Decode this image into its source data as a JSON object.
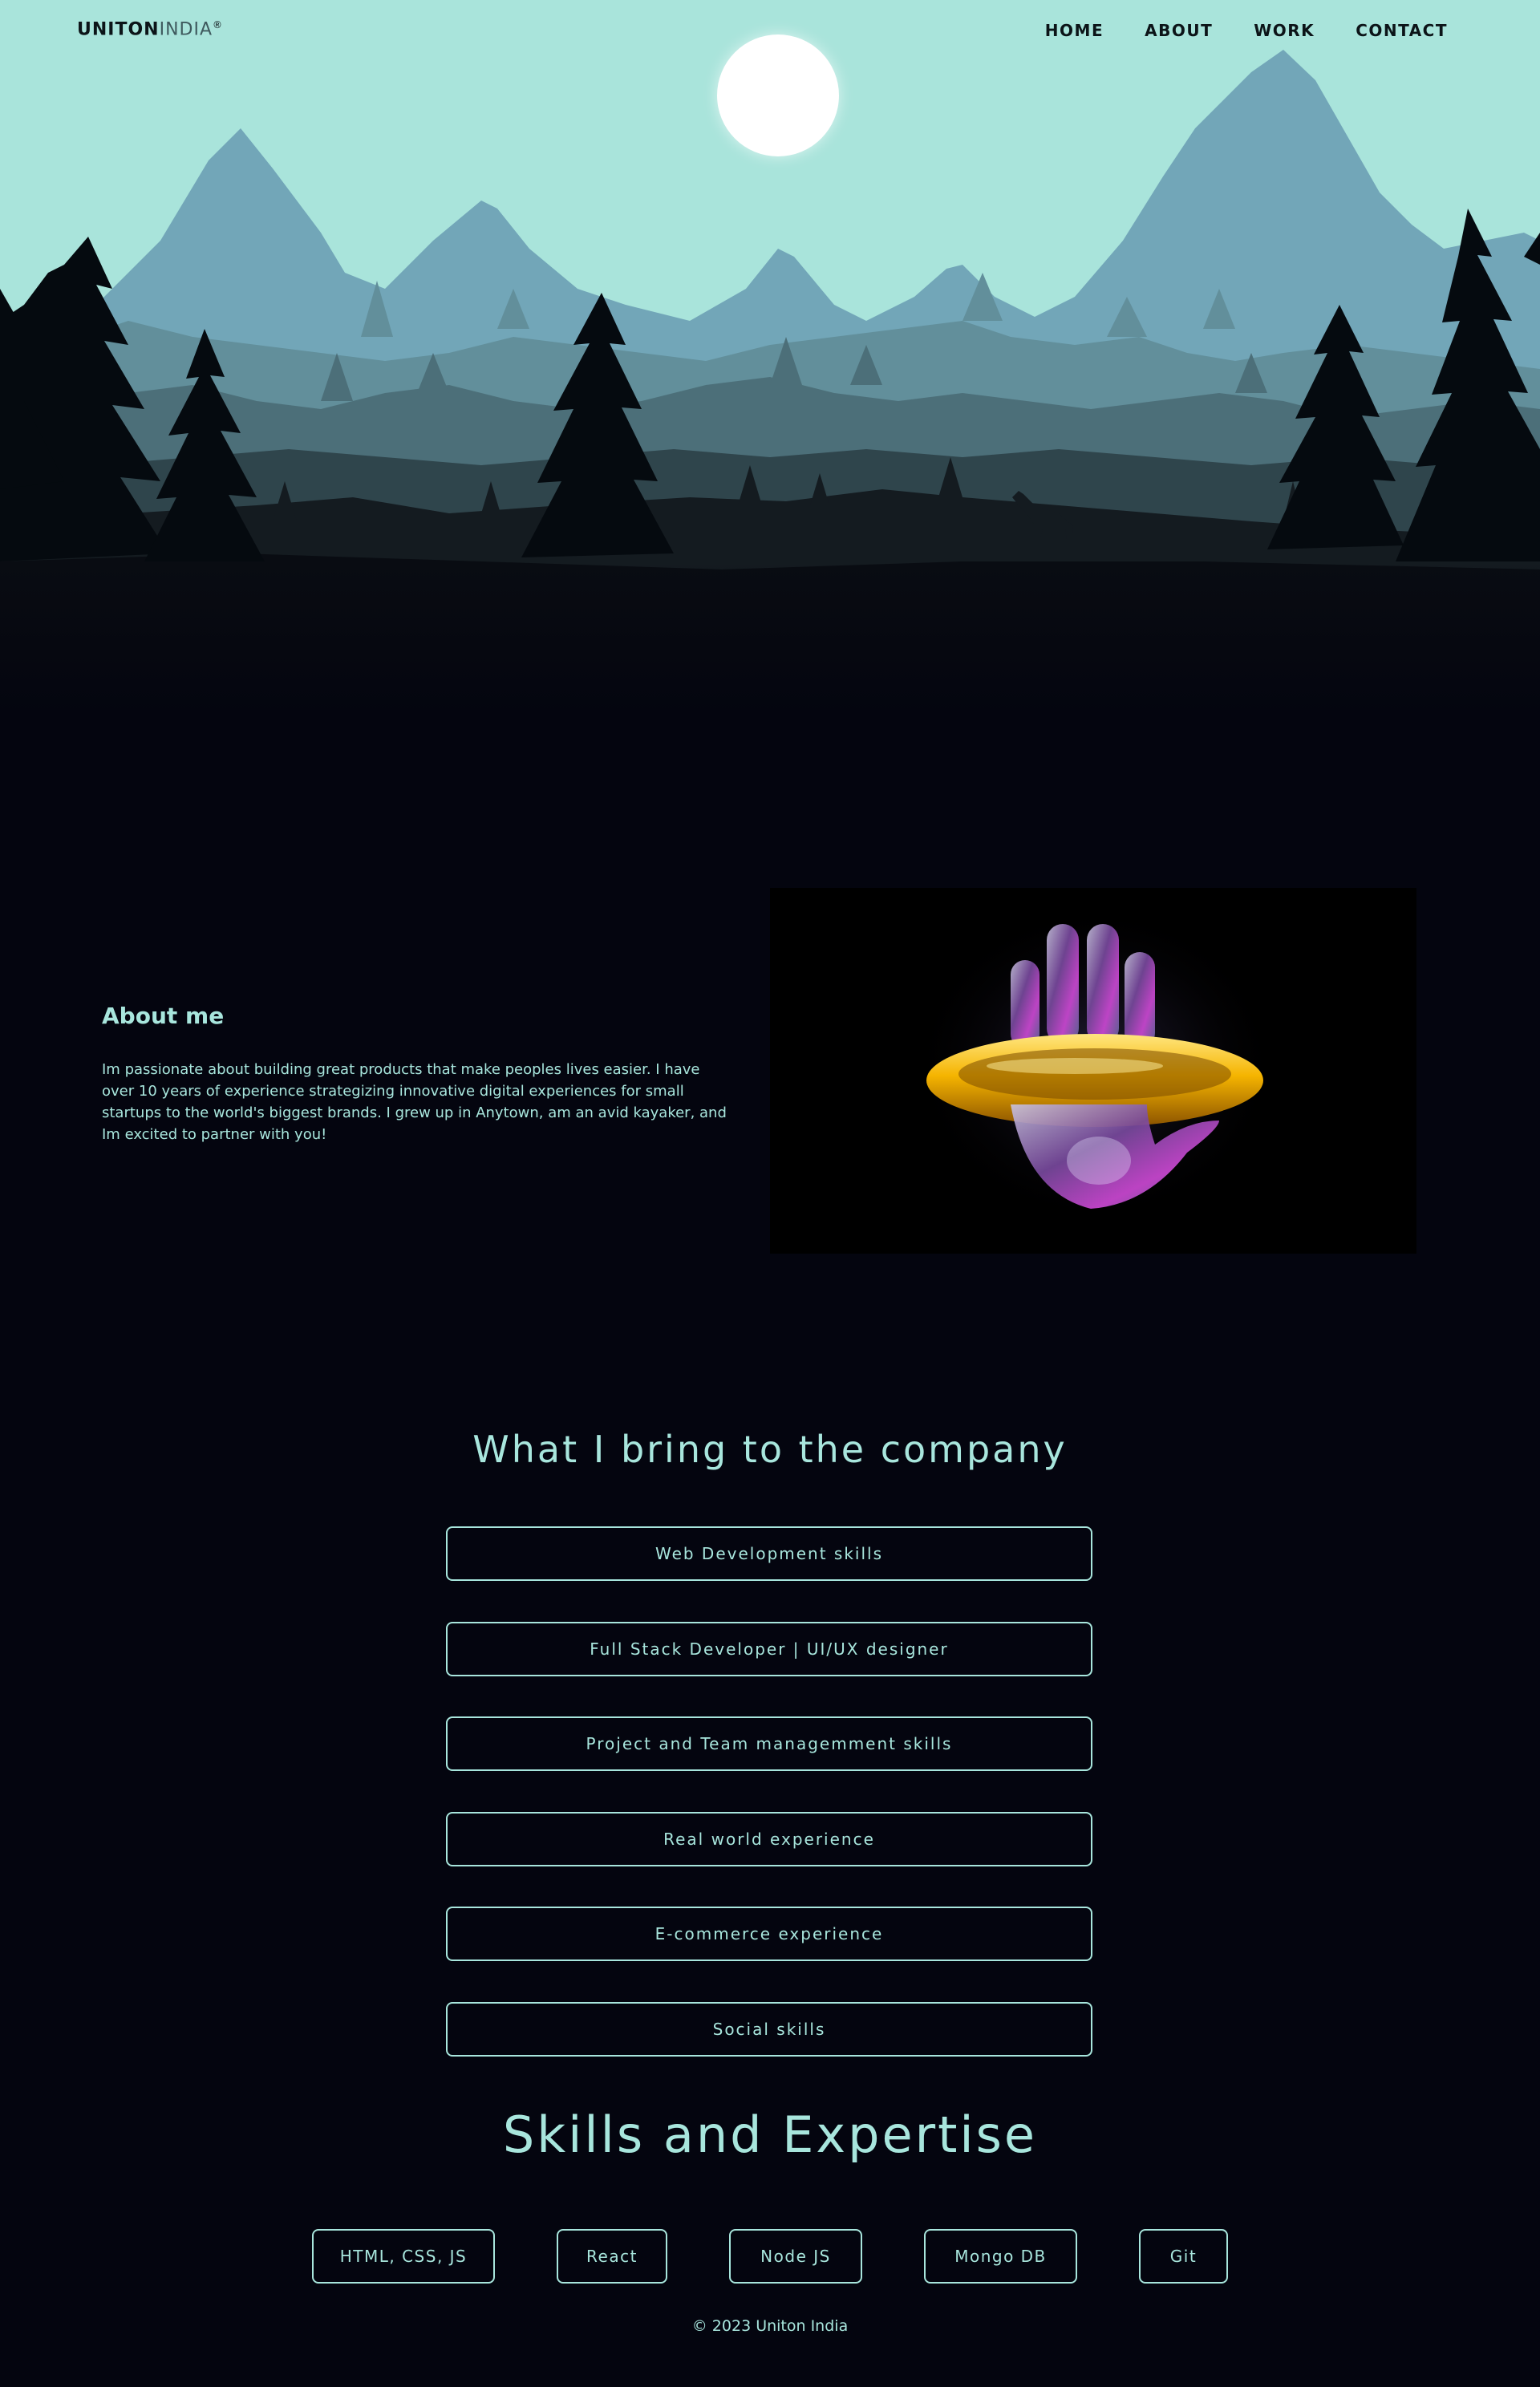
{
  "header": {
    "logo_strong": "UNITON",
    "logo_light": "INDIA",
    "logo_mark": "®",
    "nav": [
      {
        "label": "HOME"
      },
      {
        "label": "ABOUT"
      },
      {
        "label": "WORK"
      },
      {
        "label": "CONTACT"
      }
    ]
  },
  "about": {
    "title": "About me",
    "text": "Im passionate about building great products that make peoples lives easier. I have over 10 years of experience strategizing innovative digital experiences for small startups to the world's biggest brands. I grew up in Anytown, am an avid kayaker, and Im excited to partner with you!"
  },
  "bring": {
    "title": "What I bring to the company",
    "items": [
      "Web Development skills",
      "Full Stack Developer | UI/UX designer",
      "Project and Team managemment skills",
      "Real world experience",
      "E-commerce experience",
      "Social skills"
    ]
  },
  "skills": {
    "title": "Skills and Expertise",
    "items": [
      "HTML, CSS, JS",
      "React",
      "Node JS",
      "Mongo DB",
      "Git"
    ]
  },
  "footer": {
    "text": "© 2023 Uniton India"
  },
  "colors": {
    "background": "#04050f",
    "accent": "#a8e6dd",
    "sky": "#a9e4db"
  }
}
